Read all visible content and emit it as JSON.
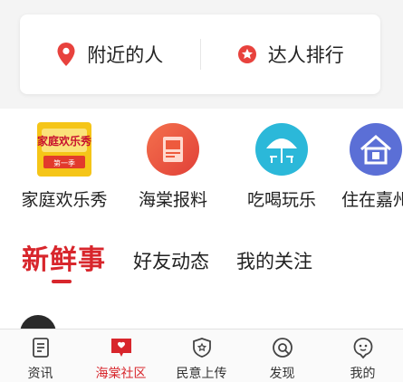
{
  "top_card": {
    "nearby_label": "附近的人",
    "ranking_label": "达人排行"
  },
  "shortcuts": [
    {
      "label": "家庭欢乐秀",
      "icon": "family-show-icon",
      "icon_text": "家庭欢乐秀",
      "icon_sub": "第一季"
    },
    {
      "label": "海棠报料",
      "icon": "news-tip-icon"
    },
    {
      "label": "吃喝玩乐",
      "icon": "leisure-umbrella-icon"
    },
    {
      "label": "住在嘉州",
      "icon": "house-icon"
    }
  ],
  "feed_tabs": {
    "active": "新鲜事",
    "friends": "好友动态",
    "following": "我的关注"
  },
  "bottom_nav": [
    {
      "label": "资讯",
      "icon": "news-icon",
      "active": false
    },
    {
      "label": "海棠社区",
      "icon": "community-icon",
      "active": true
    },
    {
      "label": "民意上传",
      "icon": "opinion-shield-icon",
      "active": false
    },
    {
      "label": "发现",
      "icon": "discover-icon",
      "active": false
    },
    {
      "label": "我的",
      "icon": "profile-face-icon",
      "active": false
    }
  ],
  "colors": {
    "accent": "#d8262c",
    "background": "#f4f4f4"
  }
}
